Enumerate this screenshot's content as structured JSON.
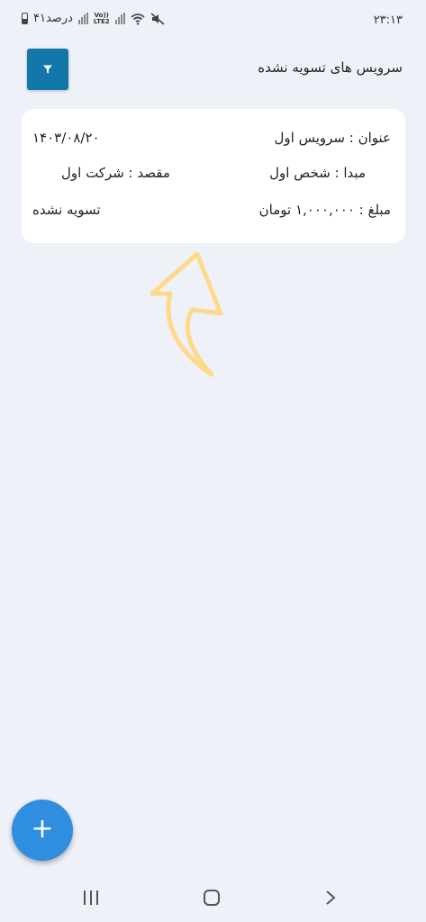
{
  "status_bar": {
    "time": "۲۳:۱۳",
    "battery_text": "۴۱درصد",
    "volte_line1": "Vo))",
    "volte_line2": "LTE2",
    "icons": [
      "battery-icon",
      "signal-icon",
      "volte-icon",
      "wifi-icon",
      "mute-icon"
    ]
  },
  "header": {
    "title": "سرویس های تسویه نشده",
    "filter_icon": "filter-icon"
  },
  "services": [
    {
      "title": "عنوان : سرویس اول",
      "date": "۱۴۰۳/۰۸/۲۰",
      "origin": "مبدا : شخص اول",
      "destination": "مقصد : شرکت اول",
      "amount": "مبلغ : ۱,۰۰۰,۰۰۰ تومان",
      "status": "تسویه نشده"
    }
  ],
  "annotation": {
    "icon": "arrow-up-icon",
    "color": "#ffd98a"
  },
  "fab": {
    "label": "+"
  },
  "nav_bar": {
    "icons": [
      "recents-icon",
      "home-icon",
      "back-icon"
    ]
  },
  "colors": {
    "background": "#eff1f9",
    "accent": "#1277a8",
    "fab": "#2f8ee0",
    "card": "#ffffff"
  }
}
